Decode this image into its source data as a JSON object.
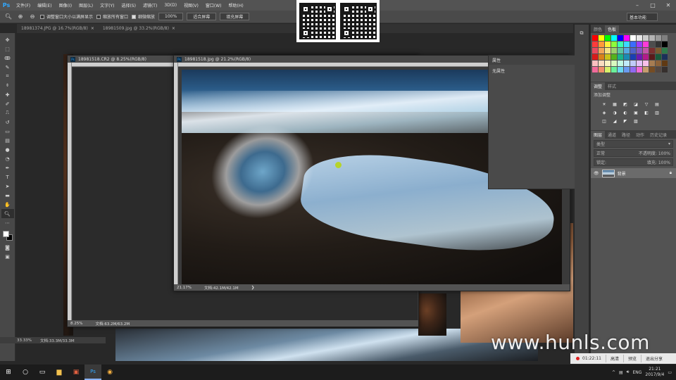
{
  "app": {
    "logo": "Ps"
  },
  "menu": [
    "文件(F)",
    "编辑(E)",
    "图像(I)",
    "图层(L)",
    "文字(Y)",
    "选择(S)",
    "滤镜(T)",
    "3D(D)",
    "视图(V)",
    "窗口(W)",
    "帮助(H)"
  ],
  "window_controls": {
    "minimize": "–",
    "maximize": "□",
    "close": "✕"
  },
  "options": {
    "check1": "调整窗口大小以满屏显示",
    "check2": "缩放所有窗口",
    "check3": "细微缩放",
    "zoom_value": "100%",
    "fit_screen": "适合屏幕",
    "fill_screen": "填充屏幕",
    "workspace": "基本功能"
  },
  "doc_tabs": [
    {
      "label": "18981374.JPG @ 16.7%(RGB/8)"
    },
    {
      "label": "18981509.jpg @ 33.2%(RGB/8)"
    }
  ],
  "windows": {
    "back": {
      "title": "18981518.CR2 @ 8.25%(RGB/8)",
      "zoom": "8.25%",
      "doc": "文档:63.2M/63.2M"
    },
    "front": {
      "title": "18981518.jpg @ 21.2%(RGB/8)",
      "zoom": "21.17%",
      "doc": "文档:42.1M/42.1M"
    },
    "bottom_status": {
      "zoom": "33.33%",
      "doc": "文档:33.3M/33.3M"
    }
  },
  "properties": {
    "title": "属性",
    "body": "无属性"
  },
  "panels": {
    "top_tabs": [
      "颜色",
      "色板"
    ],
    "adj_tabs": [
      "调整",
      "样式"
    ],
    "adj_label": "添加调整",
    "layer_tabs": [
      "图层",
      "通道",
      "路径",
      "动作",
      "历史记录"
    ],
    "kind_placeholder": "类型",
    "blend": "正常",
    "opacity": "不透明度: 100%",
    "lock": "锁定:",
    "fill": "填充: 100%",
    "layer_name": "背景"
  },
  "swatch_colors": [
    "#ff0000",
    "#ffff00",
    "#00ff00",
    "#00ffff",
    "#0000ff",
    "#ff00ff",
    "#ffffff",
    "#e6e6e6",
    "#cccccc",
    "#b3b3b3",
    "#999999",
    "#808080",
    "#ff3b3b",
    "#ff9a3b",
    "#fff23b",
    "#8cff3b",
    "#3bffb1",
    "#3bd8ff",
    "#3b6cff",
    "#9a3bff",
    "#ff3bd8",
    "#4d4d4d",
    "#333333",
    "#000000",
    "#e84a5f",
    "#f2a65a",
    "#f4e285",
    "#9ecf6c",
    "#5cc6a1",
    "#57a9e2",
    "#4f63c9",
    "#8a55c2",
    "#c255a8",
    "#7a2f2f",
    "#7a5a2f",
    "#2f7a4a",
    "#d91a1a",
    "#d9811a",
    "#c9c21a",
    "#55b31a",
    "#1ab38a",
    "#1a8ab3",
    "#1a3fb3",
    "#6b1ab3",
    "#b31a8a",
    "#5a1a1a",
    "#1a5a3a",
    "#1a2f5a",
    "#f9c0c0",
    "#f9dcc0",
    "#f9f3c0",
    "#d9f9c0",
    "#c0f9e3",
    "#c0eaf9",
    "#c0cbf9",
    "#e3c0f9",
    "#f9c0ea",
    "#a67c52",
    "#8c6239",
    "#603913",
    "#f06a9a",
    "#f0906a",
    "#d6f06a",
    "#6af09a",
    "#6ad6f0",
    "#6a9af0",
    "#906af0",
    "#f06ad6",
    "#c69c6d",
    "#754c24",
    "#534741",
    "#362f2d"
  ],
  "adjust_icons": [
    "☀",
    "▦",
    "◩",
    "◪",
    "▽",
    "▤",
    "◈",
    "◑",
    "◐",
    "▣",
    "◧",
    "▥",
    "◫",
    "◢",
    "◤",
    "▨"
  ],
  "watermark": "www.hunls.com",
  "recording": {
    "time": "01:22:11",
    "quality": "高清",
    "preview": "预览",
    "exit": "退出分享"
  },
  "taskbar": {
    "lang": "ENG",
    "time": "21:21",
    "date": "2017/9/4"
  }
}
